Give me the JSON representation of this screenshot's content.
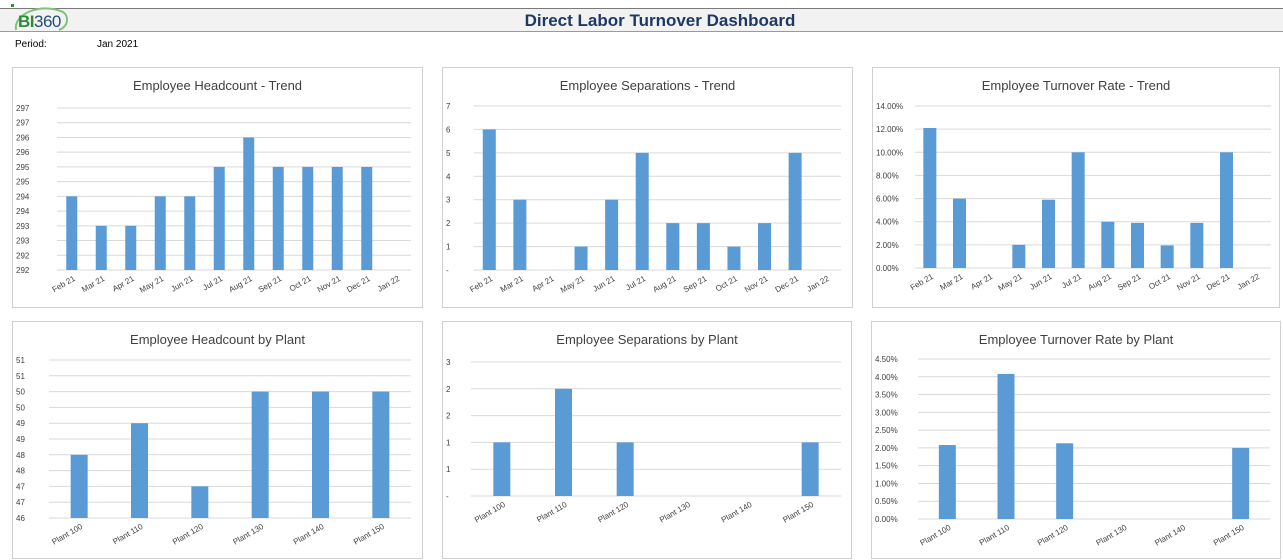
{
  "header": {
    "logo_text_prefix": "BI",
    "logo_text_suffix": "360",
    "title": "Direct Labor Turnover Dashboard",
    "period_label": "Period:",
    "period_value": "Jan 2021"
  },
  "colors": {
    "bar": "#5b9bd5",
    "grid": "#d9d9d9",
    "title": "#1f3864"
  },
  "chart_data": [
    {
      "id": "headcount-trend",
      "type": "bar",
      "title": "Employee Headcount - Trend",
      "categories": [
        "Feb 21",
        "Mar 21",
        "Apr 21",
        "May 21",
        "Jun 21",
        "Jul 21",
        "Aug 21",
        "Sep 21",
        "Oct 21",
        "Nov 21",
        "Dec 21",
        "Jan 22"
      ],
      "values": [
        294,
        293,
        293,
        294,
        294,
        295,
        296,
        295,
        295,
        295,
        295,
        null
      ],
      "ylim": [
        291.5,
        297
      ],
      "yticks": [
        291.5,
        292,
        292.5,
        293,
        293.5,
        294,
        294.5,
        295,
        295.5,
        296,
        296.5,
        297
      ],
      "ytick_labels": [
        "292",
        "292",
        "293",
        "293",
        "294",
        "294",
        "295",
        "295",
        "296",
        "296",
        "297",
        "297"
      ],
      "grid": true
    },
    {
      "id": "separations-trend",
      "type": "bar",
      "title": "Employee Separations - Trend",
      "categories": [
        "Feb 21",
        "Mar 21",
        "Apr 21",
        "May 21",
        "Jun 21",
        "Jul 21",
        "Aug 21",
        "Sep 21",
        "Oct 21",
        "Nov 21",
        "Dec 21",
        "Jan 22"
      ],
      "values": [
        6,
        3,
        0,
        1,
        3,
        5,
        2,
        2,
        1,
        2,
        5,
        null
      ],
      "ylim": [
        0,
        7
      ],
      "yticks": [
        0,
        1,
        2,
        3,
        4,
        5,
        6,
        7
      ],
      "ytick_labels": [
        "-",
        "1",
        "2",
        "3",
        "4",
        "5",
        "6",
        "7"
      ],
      "grid": true
    },
    {
      "id": "turnover-trend",
      "type": "bar",
      "title": "Employee Turnover Rate - Trend",
      "categories": [
        "Feb 21",
        "Mar 21",
        "Apr 21",
        "May 21",
        "Jun 21",
        "Jul 21",
        "Aug 21",
        "Sep 21",
        "Oct 21",
        "Nov 21",
        "Dec 21",
        "Jan 22"
      ],
      "values": [
        12.1,
        6.0,
        0,
        2.0,
        5.9,
        10.0,
        4.0,
        3.9,
        1.95,
        3.9,
        10.0,
        null
      ],
      "ylim": [
        0,
        14
      ],
      "yticks": [
        0,
        2,
        4,
        6,
        8,
        10,
        12,
        14
      ],
      "ytick_labels": [
        "0.00%",
        "2.00%",
        "4.00%",
        "6.00%",
        "8.00%",
        "10.00%",
        "12.00%",
        "14.00%"
      ],
      "grid": true
    },
    {
      "id": "headcount-plant",
      "type": "bar",
      "title": "Employee Headcount by Plant",
      "categories": [
        "Plant 100",
        "Plant 110",
        "Plant 120",
        "Plant 130",
        "Plant 140",
        "Plant 150"
      ],
      "values": [
        48,
        49,
        47,
        50,
        50,
        50
      ],
      "ylim": [
        46,
        51
      ],
      "yticks": [
        46,
        46.5,
        47,
        47.5,
        48,
        48.5,
        49,
        49.5,
        50,
        50.5,
        51
      ],
      "ytick_labels": [
        "46",
        "47",
        "47",
        "48",
        "48",
        "49",
        "49",
        "50",
        "50",
        "51",
        "51"
      ],
      "grid": true
    },
    {
      "id": "separations-plant",
      "type": "bar",
      "title": "Employee Separations by Plant",
      "categories": [
        "Plant 100",
        "Plant 110",
        "Plant 120",
        "Plant 130",
        "Plant 140",
        "Plant 150"
      ],
      "values": [
        1,
        2,
        1,
        0,
        0,
        1
      ],
      "ylim": [
        0,
        2.5
      ],
      "yticks": [
        0,
        0.5,
        1,
        1.5,
        2,
        2.5
      ],
      "ytick_labels": [
        "-",
        "1",
        "1",
        "2",
        "2",
        "3"
      ],
      "grid": true
    },
    {
      "id": "turnover-plant",
      "type": "bar",
      "title": "Employee Turnover Rate by Plant",
      "categories": [
        "Plant 100",
        "Plant 110",
        "Plant 120",
        "Plant 130",
        "Plant 140",
        "Plant 150"
      ],
      "values": [
        2.08,
        4.08,
        2.13,
        0,
        0,
        2.0
      ],
      "ylim": [
        0,
        4.5
      ],
      "yticks": [
        0,
        0.5,
        1,
        1.5,
        2,
        2.5,
        3,
        3.5,
        4,
        4.5
      ],
      "ytick_labels": [
        "0.00%",
        "0.50%",
        "1.00%",
        "1.50%",
        "2.00%",
        "2.50%",
        "3.00%",
        "3.50%",
        "4.00%",
        "4.50%"
      ],
      "grid": true
    }
  ]
}
